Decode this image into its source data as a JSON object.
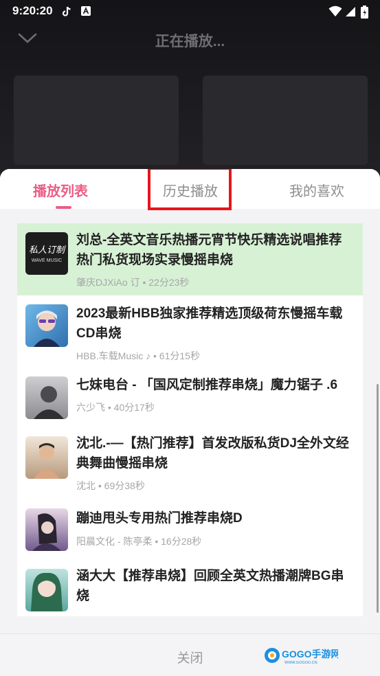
{
  "status_bar": {
    "time": "9:20:20"
  },
  "header": {
    "title": "正在播放..."
  },
  "tabs": [
    {
      "label": "播放列表",
      "active": true
    },
    {
      "label": "历史播放",
      "active": false
    },
    {
      "label": "我的喜欢",
      "active": false
    }
  ],
  "playlist": [
    {
      "title": "刘总-全英文音乐热播元宵节快乐精选说唱推荐热门私货现场实录慢摇串烧",
      "meta": "肇庆DJXiAo 订 • 22分23秒",
      "current": true,
      "thumb_text": "私人订制 WAVE MUSIC"
    },
    {
      "title": "2023最新HBB独家推荐精选顶级荷东慢摇车载CD串烧",
      "meta": "HBB.车载Music ♪ • 61分15秒",
      "current": false
    },
    {
      "title": "七妹电台 - 「国风定制推荐串烧」魔力锯子 .6",
      "meta": "六少飞 • 40分17秒",
      "current": false
    },
    {
      "title": "沈北.-—【热门推荐】首发改版私货DJ全外文经典舞曲慢摇串烧",
      "meta": "沈北 • 69分38秒",
      "current": false
    },
    {
      "title": "蹦迪甩头专用热门推荐串烧D",
      "meta": "阳晨文化 - 陈亭柔 • 16分28秒",
      "current": false
    },
    {
      "title": "涵大大【推荐串烧】回顾全英文热播潮牌BG串烧",
      "meta": "",
      "current": false
    }
  ],
  "footer": {
    "close_label": "关闭"
  },
  "watermark": {
    "text": "GOGO手游网",
    "sub": "WWW.GOGOO.CN"
  },
  "colors": {
    "accent": "#ea5d86",
    "current_row": "#d7f1d4",
    "highlight_box": "#e8141b"
  }
}
